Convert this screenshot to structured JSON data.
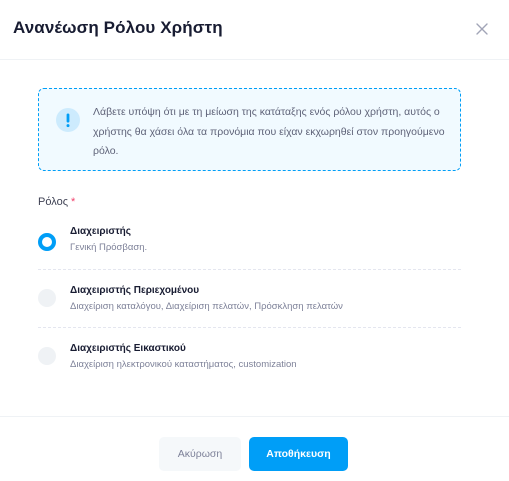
{
  "modal": {
    "title": "Ανανέωση Ρόλου Χρήστη"
  },
  "notice": {
    "text": "Λάβετε υπόψη ότι με τη μείωση της κατάταξης ενός ρόλου χρήστη, αυτός ο χρήστης θα χάσει όλα τα προνόμια που είχαν εκχωρηθεί στον προηγούμενο ρόλο."
  },
  "role_field": {
    "label": "Ρόλος",
    "required_mark": "*",
    "options": [
      {
        "title": "Διαχειριστής",
        "description": "Γενική Πρόσβαση.",
        "checked": true
      },
      {
        "title": "Διαχειριστής Περιεχομένου",
        "description": "Διαχείριση καταλόγου, Διαχείριση πελατών, Πρόσκληση πελατών",
        "checked": false
      },
      {
        "title": "Διαχειριστής Εικαστικού",
        "description": "Διαχείριση ηλεκτρονικού καταστήματος, customization",
        "checked": false
      }
    ]
  },
  "footer": {
    "cancel_label": "Ακύρωση",
    "save_label": "Αποθήκευση"
  },
  "colors": {
    "primary": "#009ef7",
    "required": "#f1416c",
    "notice_bg": "#f1faff"
  },
  "icons": {
    "close": "close-icon",
    "notice": "exclamation-icon"
  }
}
